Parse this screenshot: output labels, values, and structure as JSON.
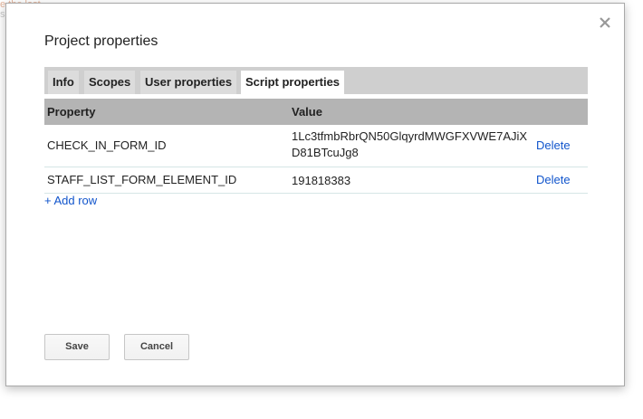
{
  "background": {
    "line1": "e the last",
    "line2": "s"
  },
  "dialog": {
    "title": "Project properties",
    "close_icon": "close-icon",
    "tabs": [
      {
        "label": "Info",
        "active": false
      },
      {
        "label": "Scopes",
        "active": false
      },
      {
        "label": "User properties",
        "active": false
      },
      {
        "label": "Script properties",
        "active": true
      }
    ],
    "table": {
      "headers": {
        "property": "Property",
        "value": "Value"
      },
      "rows": [
        {
          "property": "CHECK_IN_FORM_ID",
          "value": "1Lc3tfmbRbrQN50GlqyrdMWGFXVWE7AJiXD81BTcuJg8",
          "action": "Delete"
        },
        {
          "property": "STAFF_LIST_FORM_ELEMENT_ID",
          "value": "191818383",
          "action": "Delete"
        }
      ]
    },
    "add_row": "+ Add row",
    "buttons": {
      "save": "Save",
      "cancel": "Cancel"
    },
    "colors": {
      "link": "#1155cc",
      "header_bg": "#b4b4b4",
      "tabbar_bg": "#cfcfcf"
    }
  }
}
